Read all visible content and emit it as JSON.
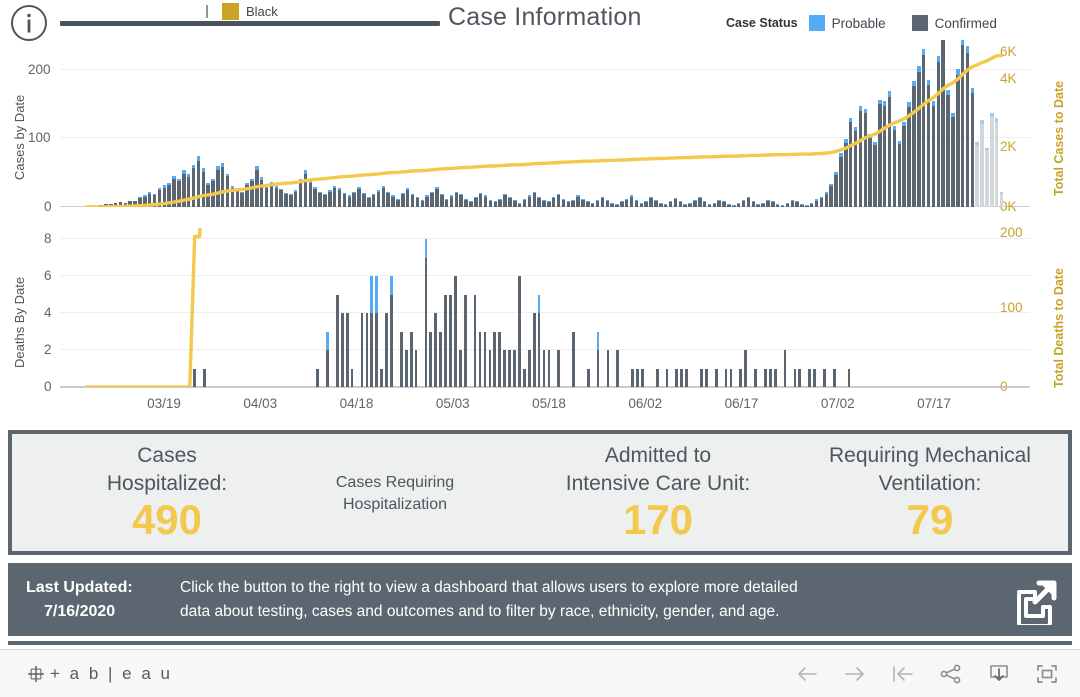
{
  "header": {
    "title": "Case Information",
    "info_icon": "info-circle-icon",
    "clipped_legend": {
      "swatch_color": "#c9a227",
      "label": "Black"
    },
    "case_status": {
      "caption": "Case Status",
      "items": [
        {
          "label": "Probable",
          "color": "#56abf5"
        },
        {
          "label": "Confirmed",
          "color": "#5b6670"
        }
      ]
    }
  },
  "chart_data": [
    {
      "type": "bar",
      "title": "Cases by Date",
      "ylabel": "Cases by Date",
      "y2label": "Total Cases to Date",
      "xlabel": "",
      "ylim": [
        0,
        260
      ],
      "yticks": [
        "0",
        "100",
        "200"
      ],
      "y2lim": [
        0,
        6500
      ],
      "y2ticks": [
        "0K",
        "2K",
        "4K",
        "6K"
      ],
      "grid": true,
      "legend": [
        "Probable",
        "Confirmed"
      ],
      "legend_position": "top-right",
      "xticks": [
        "03/19",
        "04/03",
        "04/18",
        "05/03",
        "05/18",
        "06/02",
        "06/17",
        "07/02",
        "07/17"
      ],
      "series": [
        {
          "name": "Confirmed",
          "color": "#5b6670",
          "values": [
            1,
            2,
            2,
            3,
            5,
            4,
            6,
            8,
            7,
            10,
            9,
            14,
            16,
            20,
            18,
            26,
            30,
            34,
            44,
            40,
            52,
            46,
            60,
            72,
            55,
            35,
            40,
            58,
            62,
            48,
            30,
            28,
            22,
            34,
            40,
            58,
            42,
            30,
            36,
            30,
            26,
            20,
            18,
            24,
            40,
            52,
            38,
            28,
            22,
            18,
            24,
            30,
            26,
            20,
            16,
            22,
            28,
            20,
            14,
            18,
            24,
            30,
            22,
            16,
            12,
            20,
            26,
            18,
            14,
            10,
            16,
            22,
            28,
            18,
            12,
            16,
            22,
            18,
            12,
            8,
            14,
            20,
            16,
            10,
            8,
            12,
            18,
            14,
            10,
            6,
            12,
            16,
            22,
            14,
            10,
            8,
            14,
            18,
            12,
            8,
            10,
            16,
            12,
            8,
            6,
            10,
            14,
            10,
            6,
            4,
            8,
            12,
            16,
            10,
            6,
            8,
            14,
            10,
            6,
            4,
            8,
            12,
            8,
            4,
            6,
            10,
            14,
            8,
            4,
            6,
            10,
            8,
            4,
            2,
            6,
            10,
            14,
            8,
            4,
            6,
            10,
            8,
            4,
            2,
            6,
            10,
            8,
            4,
            2,
            6,
            10,
            14,
            20,
            32,
            50,
            78,
            100,
            132,
            118,
            150,
            146,
            108,
            96,
            160,
            158,
            172,
            120,
            98,
            126,
            156,
            188,
            210,
            236,
            190,
            158,
            226,
            262,
            174,
            140,
            206,
            252,
            240,
            178,
            96,
            130,
            88,
            140,
            132,
            22
          ]
        },
        {
          "name": "Probable",
          "color": "#56abf5",
          "values": [
            0,
            0,
            0,
            0,
            0,
            0,
            0,
            0,
            0,
            0,
            0,
            2,
            2,
            3,
            2,
            3,
            4,
            4,
            5,
            4,
            6,
            5,
            6,
            8,
            5,
            3,
            4,
            6,
            6,
            4,
            3,
            2,
            2,
            3,
            4,
            6,
            4,
            3,
            3,
            3,
            2,
            2,
            2,
            2,
            4,
            5,
            4,
            3,
            2,
            2,
            2,
            3,
            3,
            2,
            2,
            2,
            3,
            2,
            1,
            2,
            2,
            3,
            2,
            2,
            1,
            2,
            3,
            2,
            1,
            1,
            2,
            2,
            3,
            2,
            1,
            2,
            2,
            2,
            1,
            1,
            1,
            2,
            2,
            1,
            1,
            1,
            2,
            2,
            1,
            1,
            1,
            2,
            2,
            1,
            1,
            1,
            2,
            2,
            1,
            1,
            1,
            2,
            1,
            1,
            1,
            1,
            2,
            1,
            1,
            1,
            1,
            1,
            2,
            1,
            1,
            1,
            2,
            1,
            1,
            1,
            1,
            2,
            1,
            1,
            1,
            1,
            2,
            1,
            1,
            1,
            1,
            1,
            1,
            1,
            1,
            1,
            2,
            1,
            1,
            1,
            1,
            1,
            1,
            1,
            1,
            1,
            1,
            1,
            1,
            1,
            2,
            2,
            3,
            4,
            5,
            6,
            6,
            7,
            6,
            7,
            7,
            6,
            5,
            7,
            7,
            8,
            6,
            5,
            6,
            7,
            8,
            9,
            10,
            8,
            7,
            9,
            11,
            8,
            6,
            9,
            10,
            10,
            7,
            5,
            6,
            4,
            6,
            6,
            2
          ]
        }
      ],
      "incomplete_tail_bars": 6,
      "cumulative_line": {
        "name": "Total Cases to Date",
        "color": "#f2c94c",
        "end_value": 5900
      }
    },
    {
      "type": "bar",
      "title": "Deaths By Date",
      "ylabel": "Deaths By Date",
      "y2label": "Total Deaths to Date",
      "xlabel": "",
      "ylim": [
        0,
        8.6
      ],
      "yticks": [
        "0",
        "2",
        "4",
        "6",
        "8"
      ],
      "y2lim": [
        0,
        225
      ],
      "y2ticks": [
        "0",
        "100",
        "200"
      ],
      "grid": true,
      "xticks": [
        "03/19",
        "04/03",
        "04/18",
        "05/03",
        "05/18",
        "06/02",
        "06/17",
        "07/02",
        "07/17"
      ],
      "series": [
        {
          "name": "Confirmed",
          "color": "#5b6670",
          "values": [
            0,
            0,
            0,
            0,
            0,
            0,
            0,
            0,
            0,
            0,
            0,
            0,
            0,
            0,
            0,
            0,
            0,
            0,
            0,
            0,
            0,
            0,
            1,
            0,
            1,
            0,
            0,
            0,
            0,
            0,
            0,
            0,
            0,
            0,
            0,
            0,
            0,
            0,
            0,
            0,
            0,
            0,
            0,
            0,
            0,
            0,
            0,
            1,
            0,
            2,
            0,
            5,
            4,
            4,
            1,
            0,
            4,
            4,
            4,
            4,
            1,
            4,
            5,
            0,
            3,
            2,
            3,
            2,
            0,
            7,
            3,
            4,
            3,
            5,
            5,
            6,
            2,
            5,
            0,
            5,
            3,
            3,
            2,
            3,
            3,
            2,
            2,
            2,
            6,
            1,
            2,
            4,
            4,
            2,
            2,
            0,
            2,
            0,
            0,
            3,
            0,
            0,
            1,
            0,
            2,
            0,
            2,
            0,
            2,
            0,
            0,
            1,
            1,
            1,
            0,
            0,
            1,
            0,
            1,
            0,
            1,
            1,
            1,
            0,
            0,
            1,
            1,
            0,
            1,
            0,
            1,
            1,
            0,
            1,
            2,
            0,
            1,
            0,
            1,
            1,
            1,
            0,
            2,
            0,
            1,
            1,
            0,
            1,
            1,
            0,
            1,
            0,
            1,
            0,
            0,
            1,
            0,
            0,
            0,
            0,
            0,
            0,
            0,
            0,
            0,
            0,
            0,
            0,
            0,
            0,
            0,
            0,
            0,
            0,
            0,
            0,
            0,
            0,
            0,
            0,
            0,
            0,
            0,
            0,
            0,
            0,
            0
          ]
        },
        {
          "name": "Probable",
          "color": "#56abf5",
          "values": [
            0,
            0,
            0,
            0,
            0,
            0,
            0,
            0,
            0,
            0,
            0,
            0,
            0,
            0,
            0,
            0,
            0,
            0,
            0,
            0,
            0,
            0,
            0,
            0,
            0,
            0,
            0,
            0,
            0,
            0,
            0,
            0,
            0,
            0,
            0,
            0,
            0,
            0,
            0,
            0,
            0,
            0,
            0,
            0,
            0,
            0,
            0,
            0,
            0,
            1,
            0,
            0,
            0,
            0,
            0,
            0,
            0,
            0,
            2,
            2,
            0,
            0,
            1,
            0,
            0,
            0,
            0,
            0,
            0,
            1,
            0,
            0,
            0,
            0,
            0,
            0,
            0,
            0,
            0,
            0,
            0,
            0,
            0,
            0,
            0,
            0,
            0,
            0,
            0,
            0,
            0,
            0,
            1,
            0,
            0,
            0,
            0,
            0,
            0,
            0,
            0,
            0,
            0,
            0,
            1,
            0,
            0,
            0,
            0,
            0,
            0,
            0,
            0,
            0,
            0,
            0,
            0,
            0,
            0,
            0,
            0,
            0,
            0,
            0,
            0,
            0,
            0,
            0,
            0,
            0,
            0,
            0,
            0,
            0,
            0,
            0,
            0,
            0,
            0,
            0,
            0,
            0,
            0,
            0,
            0,
            0,
            0,
            0,
            0,
            0,
            0,
            0,
            0,
            0,
            0,
            0,
            0,
            0,
            0,
            0,
            0,
            0,
            0,
            0,
            0,
            0,
            0,
            0,
            0,
            0,
            0,
            0,
            0,
            0,
            0,
            0,
            0
          ]
        }
      ],
      "cumulative_line": {
        "name": "Total Deaths to Date",
        "color": "#f2c94c",
        "end_value": 213
      }
    }
  ],
  "kpis": [
    {
      "label_line1": "Cases",
      "label_line2": "Hospitalized:",
      "value": "490",
      "name": "cases-hospitalized"
    },
    {
      "note_line1": "Cases Requiring",
      "note_line2": "Hospitalization",
      "name": "hospitalization-note"
    },
    {
      "label_line1": "Admitted to",
      "label_line2": "Intensive Care Unit:",
      "value": "170",
      "name": "admitted-icu"
    },
    {
      "label_line1": "Requiring Mechanical",
      "label_line2": "Ventilation:",
      "value": "79",
      "name": "mechanical-ventilation"
    }
  ],
  "banner": {
    "updated_label": "Last Updated:",
    "updated_date": "7/16/2020",
    "text_line1": "Click the button to the right to view a dashboard that allows users to explore more detailed",
    "text_line2": "data about testing, cases and outcomes and to filter by race, ethnicity, gender, and age.",
    "button_icon": "external-link-icon"
  },
  "tableau_bar": {
    "wordmark": "+ a b | e a u",
    "tools": [
      {
        "name": "back-icon"
      },
      {
        "name": "forward-icon"
      },
      {
        "name": "revert-icon"
      },
      {
        "name": "share-icon"
      },
      {
        "name": "download-icon"
      },
      {
        "name": "fullscreen-icon"
      }
    ]
  },
  "colors": {
    "confirmed": "#5b6670",
    "probable": "#56abf5",
    "cumulative": "#f2c94c",
    "incomplete": "#d4d7da",
    "gold_text": "#c9a227",
    "value_gold": "#f2c94c"
  }
}
